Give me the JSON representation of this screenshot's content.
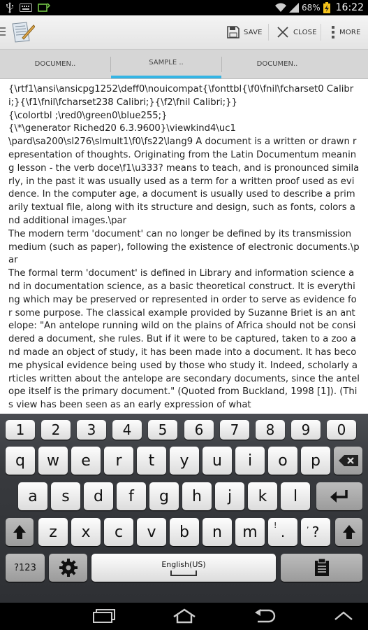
{
  "status": {
    "battery_percent": "68%",
    "time": "16:22"
  },
  "toolbar": {
    "save_label": "SAVE",
    "close_label": "CLOSE",
    "more_label": "MORE"
  },
  "tabs": [
    {
      "label": "DOCUMEN.."
    },
    {
      "label": "SAMPLE .."
    },
    {
      "label": "DOCUMEN.."
    }
  ],
  "document": {
    "text": "{\\rtf1\\ansi\\ansicpg1252\\deff0\\nouicompat{\\fonttbl{\\f0\\fnil\\fcharset0 Calibri;}{\\f1\\fnil\\fcharset238 Calibri;}{\\f2\\fnil Calibri;}}\n{\\colortbl ;\\red0\\green0\\blue255;}\n{\\*\\generator Riched20 6.3.9600}\\viewkind4\\uc1\n\\pard\\sa200\\sl276\\slmult1\\f0\\fs22\\lang9 A document is a written or drawn representation of thoughts. Originating from the Latin Documentum meaning lesson - the verb doce\\f1\\u333? means to teach, and is pronounced similarly, in the past it was usually used as a term for a written proof used as evidence. In the computer age, a document is usually used to describe a primarily textual file, along with its structure and design, such as fonts, colors and additional images.\\par\nThe modern term 'document' can no longer be defined by its transmission medium (such as paper), following the existence of electronic documents.\\par\nThe formal term 'document' is defined in Library and information science and in documentation science, as a basic theoretical construct. It is everything which may be preserved or represented in order to serve as evidence for some purpose. The classical example provided by Suzanne Briet is an antelope: \"An antelope running wild on the plains of Africa should not be considered a document, she rules. But if it were to be captured, taken to a zoo and made an object of study, it has been made into a document. It has become physical evidence being used by those who study it. Indeed, scholarly articles written about the antelope are secondary documents, since the antelope itself is the primary document.\" (Quoted from Buckland, 1998 [1]). (This view has been seen as an early expression of what"
  },
  "keyboard": {
    "numbers": [
      "1",
      "2",
      "3",
      "4",
      "5",
      "6",
      "7",
      "8",
      "9",
      "0"
    ],
    "row1": [
      "q",
      "w",
      "e",
      "r",
      "t",
      "y",
      "u",
      "i",
      "o",
      "p"
    ],
    "row2": [
      "a",
      "s",
      "d",
      "f",
      "g",
      "h",
      "j",
      "k",
      "l"
    ],
    "row3": [
      "z",
      "x",
      "c",
      "v",
      "b",
      "n",
      "m"
    ],
    "punct1": {
      "main": ".",
      "alt": "!"
    },
    "punct2": {
      "main": "?",
      "alt": ","
    },
    "symbols_label": "?123",
    "language_label": "English(US)"
  },
  "colors": {
    "accent": "#33b5e5"
  }
}
